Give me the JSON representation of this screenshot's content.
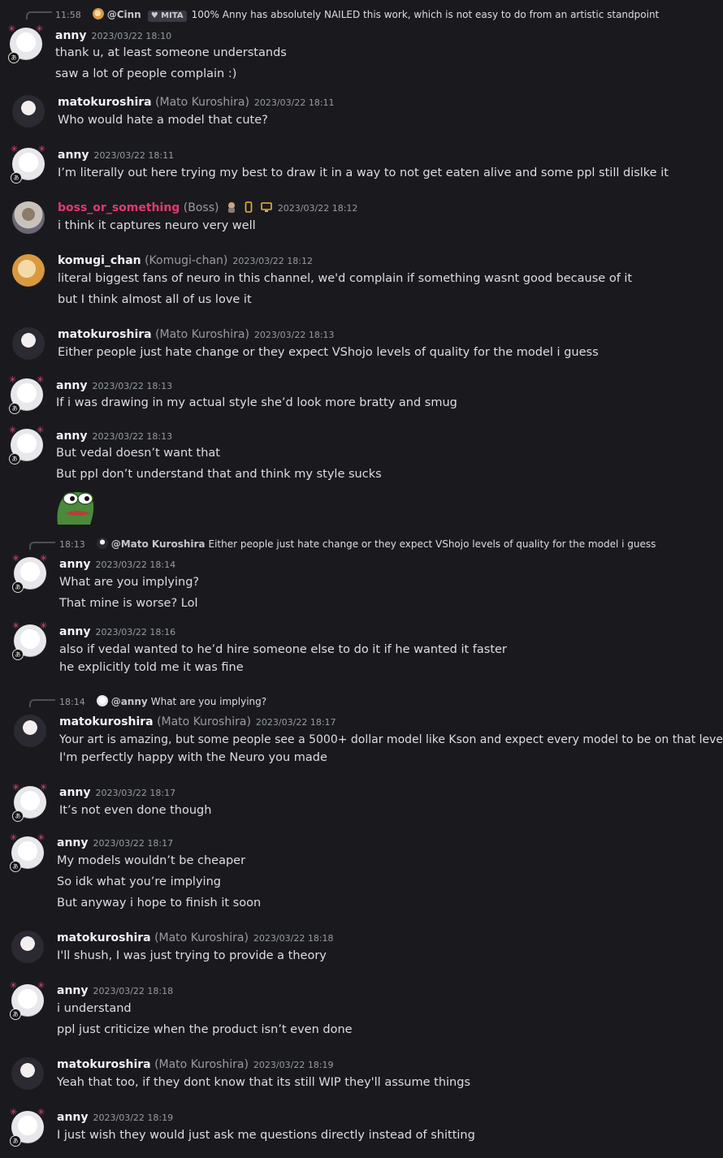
{
  "messages": [
    {
      "reply": {
        "time": "11:58",
        "author": "@Cinn",
        "role": "MITA",
        "text": "100% Anny has absolutely NAILED this work, which is not easy to do from an artistic standpoint"
      },
      "author": "anny",
      "alias": "",
      "time": "2023/03/22 18:10",
      "lines": [
        "thank u, at least someone understands",
        "saw a lot of people complain :)"
      ]
    },
    {
      "author": "matokuroshira",
      "alias": "(Mato Kuroshira)",
      "time": "2023/03/22 18:11",
      "lines": [
        "Who would hate a model that cute?"
      ]
    },
    {
      "author": "anny",
      "alias": "",
      "time": "2023/03/22 18:11",
      "lines": [
        "I’m literally out here trying my best to draw it in a way to not get eaten alive and some ppl still dislke it"
      ]
    },
    {
      "author": "boss_or_something",
      "alias": "(Boss)",
      "time": "2023/03/22 18:12",
      "lines": [
        "i think it captures neuro very well"
      ]
    },
    {
      "author": "komugi_chan",
      "alias": "(Komugi-chan)",
      "time": "2023/03/22 18:12",
      "lines": [
        "literal biggest fans of neuro in this channel, we'd complain if something wasnt good because of it",
        "but I think almost all of us love it"
      ]
    },
    {
      "author": "matokuroshira",
      "alias": "(Mato Kuroshira)",
      "time": "2023/03/22 18:13",
      "lines": [
        "Either people just hate change or they expect VShojo levels of quality for the model i guess"
      ]
    },
    {
      "author": "anny",
      "alias": "",
      "time": "2023/03/22 18:13",
      "lines": [
        "If i was drawing in my actual style she’d look more bratty and smug"
      ]
    },
    {
      "author": "anny",
      "alias": "",
      "time": "2023/03/22 18:13",
      "lines": [
        "But vedal doesn’t want that",
        "But ppl don’t understand that and think my style sucks"
      ]
    },
    {
      "reply": {
        "time": "18:13",
        "author": "@Mato Kuroshira",
        "text": "Either people just hate change or they expect VShojo levels of quality for the model i guess"
      },
      "author": "anny",
      "alias": "",
      "time": "2023/03/22 18:14",
      "lines": [
        "What are you implying?",
        "That mine is worse? Lol"
      ]
    },
    {
      "author": "anny",
      "alias": "",
      "time": "2023/03/22 18:16",
      "lines": [
        "also if vedal wanted to he’d hire someone else to do it if he wanted it faster",
        "he explicitly told me it was fine"
      ]
    },
    {
      "reply": {
        "time": "18:14",
        "author": "@anny",
        "text": "What are you implying?"
      },
      "author": "matokuroshira",
      "alias": "(Mato Kuroshira)",
      "time": "2023/03/22 18:17",
      "lines": [
        "Your art is amazing, but some people see a 5000+ dollar model like Kson and expect every model to be on that level lol",
        "I'm perfectly happy with the Neuro you made"
      ]
    },
    {
      "author": "anny",
      "alias": "",
      "time": "2023/03/22 18:17",
      "lines": [
        "It’s not even done though"
      ]
    },
    {
      "author": "anny",
      "alias": "",
      "time": "2023/03/22 18:17",
      "lines": [
        "My models wouldn’t be cheaper",
        "So idk what you’re implying",
        "But anyway i hope to finish it soon"
      ]
    },
    {
      "author": "matokuroshira",
      "alias": "(Mato Kuroshira)",
      "time": "2023/03/22 18:18",
      "lines": [
        "I'll shush, I was just trying to provide a theory"
      ]
    },
    {
      "author": "anny",
      "alias": "",
      "time": "2023/03/22 18:18",
      "lines": [
        "i understand",
        "ppl just criticize when the product isn’t even done"
      ]
    },
    {
      "author": "matokuroshira",
      "alias": "(Mato Kuroshira)",
      "time": "2023/03/22 18:19",
      "lines": [
        "Yeah that too, if they dont know that its still WIP they'll assume things"
      ]
    },
    {
      "author": "anny",
      "alias": "",
      "time": "2023/03/22 18:19",
      "lines": [
        "I just wish they would just ask me questions directly instead of shitting"
      ]
    }
  ],
  "icons": {
    "sticker": "pepe-sticker",
    "role_icon": "heart-icon",
    "boss_badges": [
      "character-icon",
      "phone-icon",
      "desktop-icon"
    ]
  },
  "colors": {
    "background": "#1a1a1e",
    "highlight_name": "#e5386f"
  }
}
